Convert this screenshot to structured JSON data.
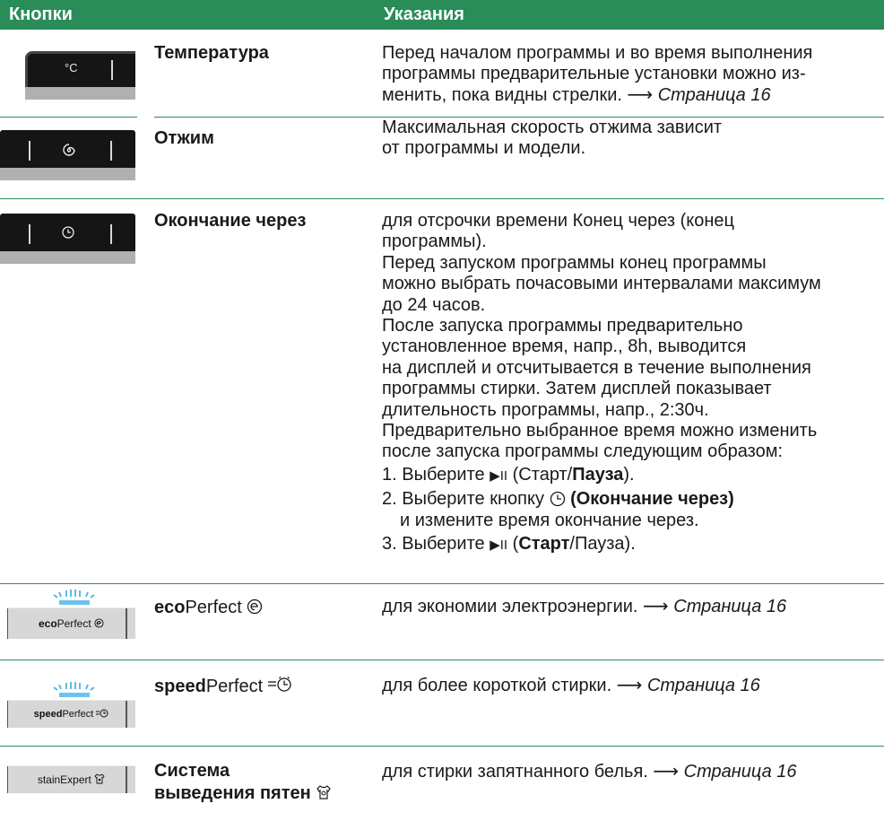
{
  "header": {
    "col1": "Кнопки",
    "col2": "Указания"
  },
  "colors": {
    "accent": "#2a8d59"
  },
  "rows": {
    "temperature": {
      "name": "Температура",
      "panel_label": "°C",
      "desc": [
        "Перед началом программы и во время выполнения",
        "программы предварительные установки можно из-",
        "менить, пока видны стрелки. "
      ],
      "arrow": "⟶",
      "link": "Страница 16"
    },
    "spin": {
      "name": "Отжим",
      "icon": "spin-icon",
      "desc": [
        "Максимальная скорость отжима зависит",
        "от программы и модели."
      ]
    },
    "finish": {
      "name": "Окончание через",
      "icon": "clock-icon",
      "desc": [
        "для отсрочки времени Конец через (конец",
        "программы).",
        "Перед запуском программы конец программы",
        "можно выбрать почасовыми интервалами максимум",
        "до 24 часов.",
        "После запуска программы предварительно",
        "установленное время, напр., 8h, выводится",
        "на дисплей и отсчитывается в течение выполнения",
        "программы стирки. Затем дисплей показывает",
        "длительность программы, напр., 2:30ч.",
        "Предварительно выбранное время можно изменить",
        "после запуска программы следующим образом:"
      ],
      "steps": {
        "s1_pre": "1. Выберите ",
        "s1_icon": "▶II",
        "s1_open": " (Старт/",
        "s1_bold": "Пауза",
        "s1_close": ").",
        "s2_pre": "2. Выберите кнопку ",
        "s2_bold": "(Окончание через)",
        "s2_cont": "и измените время окончание через.",
        "s3_pre": "3. Выберите ",
        "s3_icon": "▶II",
        "s3_open": " (",
        "s3_bold": "Старт",
        "s3_close": "/Пауза)."
      }
    },
    "eco": {
      "name_bold": "eco",
      "name_light": "Perfect",
      "icon": "eco-icon",
      "panel_bold": "eco",
      "panel_light": "Perfect",
      "desc": "для экономии электроэнергии. ",
      "arrow": "⟶",
      "link": "Страница 16"
    },
    "speed": {
      "name_bold": "speed",
      "name_light": "Perfect",
      "icon": "speed-clock-icon",
      "panel_bold": "speed",
      "panel_light": "Perfect",
      "desc": "для более короткой стирки. ",
      "arrow": "⟶",
      "link": "Страница 16"
    },
    "stain": {
      "name_line1": "Система",
      "name_line2": "выведения пятен",
      "icon": "stain-shirt-icon",
      "panel_label": "stainExpert",
      "desc": "для стирки запятнанного белья. ",
      "arrow": "⟶",
      "link": "Страница 16"
    }
  }
}
